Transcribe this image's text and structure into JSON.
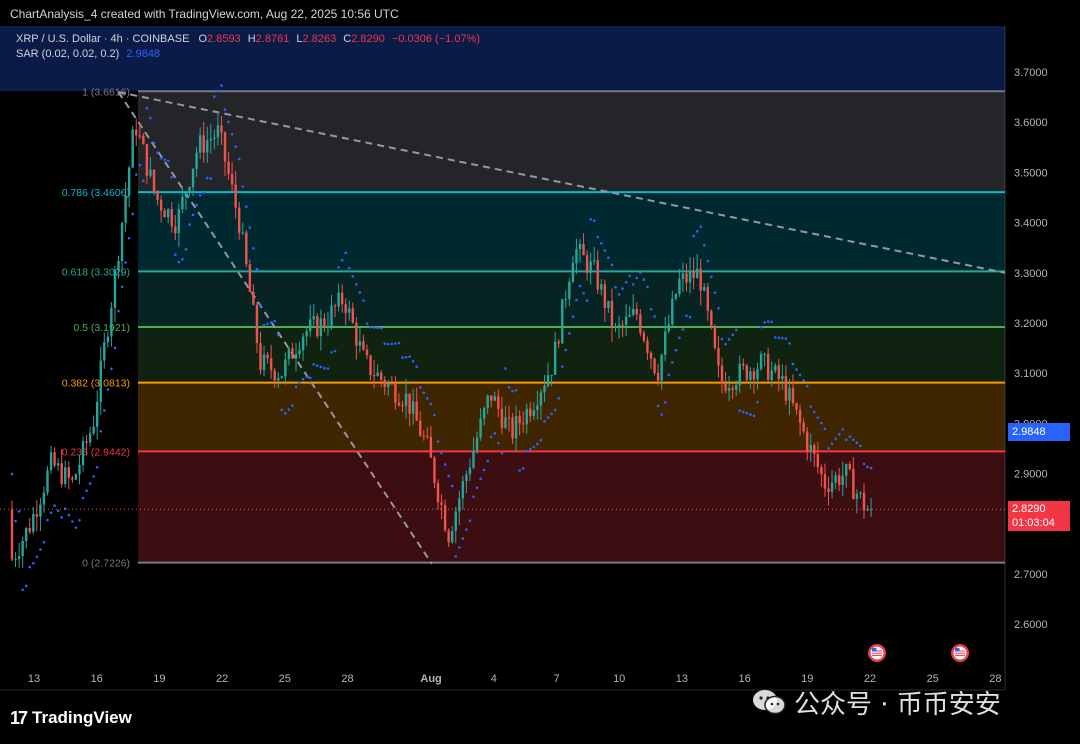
{
  "header": {
    "credit": "ChartAnalysis_4 created with TradingView.com, Aug 22, 2025 10:56 UTC"
  },
  "legend": {
    "symbol": "XRP / U.S. Dollar · 4h · COINBASE",
    "open_label": "O",
    "open": "2.8593",
    "high_label": "H",
    "high": "2.8761",
    "low_label": "L",
    "low": "2.8263",
    "close_label": "C",
    "close": "2.8290",
    "change": "−0.0306 (−1.07%)",
    "indicator": "SAR (0.02, 0.02, 0.2)",
    "indicator_value": "2.9848"
  },
  "price_tags": {
    "sar": "2.9848",
    "last_price": "2.8290",
    "countdown": "01:03:04"
  },
  "branding": {
    "logo_mark": "17",
    "logo_text": "TradingView",
    "watermark": "公众号 · 币币安安"
  },
  "colors": {
    "up": "#26a69a",
    "down": "#ef5350",
    "sar": "#2962ff",
    "fib_1": "#787b86",
    "fib_0786": "#00bcd4",
    "fib_0618": "#26a69a",
    "fib_05": "#4caf50",
    "fib_0382": "#ff9800",
    "fib_0236": "#f23645",
    "fib_0": "#787b86"
  },
  "chart_data": {
    "type": "candlestick",
    "symbol": "XRP / U.S. Dollar",
    "interval": "4h",
    "exchange": "COINBASE",
    "y_axis": {
      "min": 2.55,
      "max": 3.75,
      "ticks": [
        "3.7000",
        "3.6000",
        "3.5000",
        "3.4000",
        "3.3000",
        "3.2000",
        "3.1000",
        "3.0000",
        "2.9000",
        "2.8000",
        "2.7000",
        "2.6000"
      ]
    },
    "x_axis": {
      "ticks": [
        "13",
        "16",
        "19",
        "22",
        "25",
        "28",
        "Aug",
        "4",
        "7",
        "10",
        "13",
        "16",
        "19",
        "22",
        "25",
        "28"
      ]
    },
    "fibonacci": [
      {
        "label": "1 (3.6616)",
        "value": 3.6616
      },
      {
        "label": "0.786 (3.4606)",
        "value": 3.4606
      },
      {
        "label": "0.618 (3.3029)",
        "value": 3.3029
      },
      {
        "label": "0.5 (3.1921)",
        "value": 3.1921
      },
      {
        "label": "0.382 (3.0813)",
        "value": 3.0813
      },
      {
        "label": "0.236 (2.9442)",
        "value": 2.9442
      },
      {
        "label": "0 (2.7226)",
        "value": 2.7226
      }
    ],
    "trendline": {
      "from": {
        "date": "Jul 18",
        "price": 3.66
      },
      "to": {
        "date": "Aug 28",
        "price": 3.3
      }
    },
    "fib_drawline": {
      "from": {
        "date": "Jul 18",
        "price": 3.66
      },
      "to": {
        "date": "Aug 2",
        "price": 2.72
      }
    },
    "close_path": [
      [
        "Jul 12",
        2.72
      ],
      [
        "Jul 13",
        2.8
      ],
      [
        "Jul 14",
        2.92
      ],
      [
        "Jul 15",
        2.88
      ],
      [
        "Jul 16",
        3.0
      ],
      [
        "Jul 17",
        3.28
      ],
      [
        "Jul 18",
        3.6
      ],
      [
        "Jul 19",
        3.45
      ],
      [
        "Jul 20",
        3.4
      ],
      [
        "Jul 21",
        3.55
      ],
      [
        "Jul 22",
        3.58
      ],
      [
        "Jul 23",
        3.4
      ],
      [
        "Jul 24",
        3.12
      ],
      [
        "Jul 25",
        3.1
      ],
      [
        "Jul 26",
        3.18
      ],
      [
        "Jul 27",
        3.2
      ],
      [
        "Jul 28",
        3.25
      ],
      [
        "Jul 29",
        3.12
      ],
      [
        "Jul 30",
        3.08
      ],
      [
        "Jul 31",
        3.05
      ],
      [
        "Aug 1",
        2.95
      ],
      [
        "Aug 2",
        2.78
      ],
      [
        "Aug 3",
        2.92
      ],
      [
        "Aug 4",
        3.06
      ],
      [
        "Aug 5",
        2.98
      ],
      [
        "Aug 6",
        3.04
      ],
      [
        "Aug 7",
        3.12
      ],
      [
        "Aug 8",
        3.35
      ],
      [
        "Aug 9",
        3.3
      ],
      [
        "Aug 10",
        3.18
      ],
      [
        "Aug 11",
        3.22
      ],
      [
        "Aug 12",
        3.1
      ],
      [
        "Aug 13",
        3.28
      ],
      [
        "Aug 14",
        3.3
      ],
      [
        "Aug 15",
        3.08
      ],
      [
        "Aug 16",
        3.1
      ],
      [
        "Aug 17",
        3.12
      ],
      [
        "Aug 18",
        3.08
      ],
      [
        "Aug 19",
        2.98
      ],
      [
        "Aug 20",
        2.88
      ],
      [
        "Aug 21",
        2.9
      ],
      [
        "Aug 22",
        2.829
      ]
    ],
    "last_close": 2.829,
    "sar_current": 2.9848
  }
}
